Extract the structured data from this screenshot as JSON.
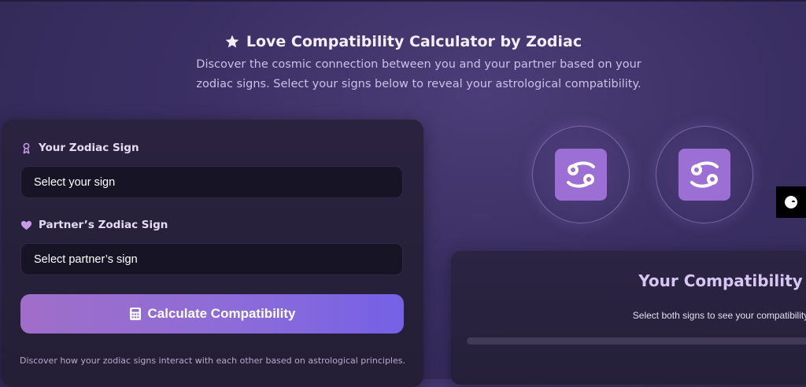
{
  "header": {
    "title": "Love Compatibility Calculator by Zodiac",
    "title_icon": "star-icon",
    "subtitle_line1": "Discover the cosmic connection between you and your partner based on your",
    "subtitle_line2": "zodiac signs. Select your signs below to reveal your astrological compatibility."
  },
  "form": {
    "your_sign_label": "Your Zodiac Sign",
    "your_sign_icon": "person-badge-icon",
    "your_sign_value": "Select your sign",
    "partner_sign_label": "Partner’s Zodiac Sign",
    "partner_sign_icon": "heart-icon",
    "partner_sign_value": "Select partner’s sign",
    "calculate_label": "Calculate Compatibility",
    "calculate_icon": "calculator-icon",
    "footnote": "Discover how your zodiac signs interact with each other based on astrological principles."
  },
  "signs": {
    "your_sign_symbol": "cancer-symbol-icon",
    "partner_sign_symbol": "cancer-symbol-icon"
  },
  "result": {
    "title": "Your Compatibility",
    "message": "Select both signs to see your compatibility",
    "progress_fraction": 0
  },
  "colors": {
    "accent": "#9b6fd4",
    "button_start": "#a06ec9",
    "button_end": "#7561e6"
  }
}
